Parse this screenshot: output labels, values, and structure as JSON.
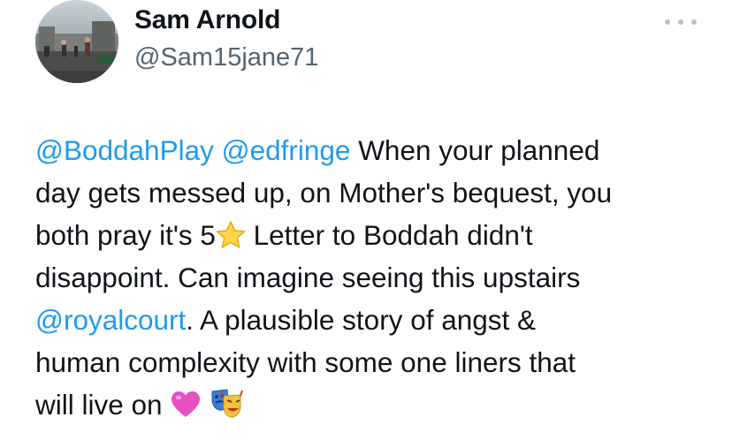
{
  "author": {
    "name": "Sam Arnold",
    "handle": "@Sam15jane71",
    "avatar_icon": "avatar-photo"
  },
  "menu": {
    "icon": "more-options-icon",
    "dot_color": "#b9c2c9"
  },
  "colors": {
    "text": "#0f1419",
    "secondary": "#536471",
    "link": "#1d9bf0"
  },
  "tweet": {
    "mention_boddah": "@BoddahPlay",
    "mention_edfringe": "@edfringe",
    "line1_text": " When your planned",
    "line2_text": "day gets messed up, on Mother's bequest, you",
    "line3_text": "both pray it's 5",
    "emoji_star": "star-emoji",
    "line3_text_after": " Letter to Boddah didn't",
    "line4_text": "disappoint. Can imagine seeing this upstairs",
    "mention_royalcourt": "@royalcourt",
    "line5_text": ". A plausible story of angst &",
    "line6_text": "human complexity with some one liners that",
    "line7_text": "will live on ",
    "emoji_heart": "pink-heart-emoji",
    "emoji_masks": "performing-arts-emoji"
  }
}
